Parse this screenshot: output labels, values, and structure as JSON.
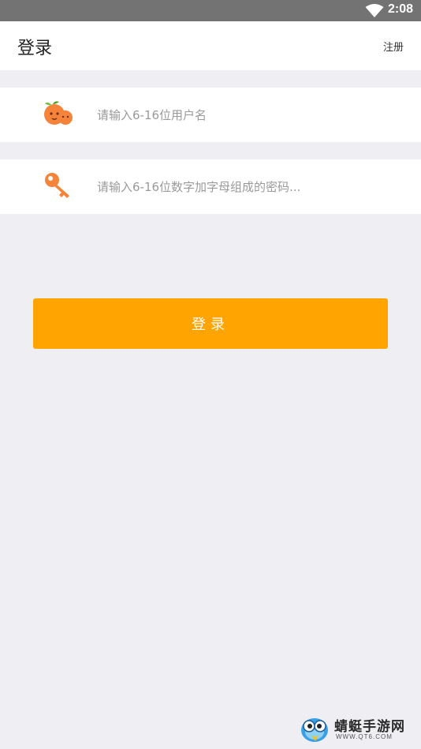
{
  "status_bar": {
    "time": "2:08"
  },
  "app_bar": {
    "title": "登录",
    "register_label": "注册"
  },
  "form": {
    "username_placeholder": "请输入6-16位用户名",
    "password_placeholder": "请输入6-16位数字加字母组成的密码..."
  },
  "login_button": {
    "label": "登录"
  },
  "watermark": {
    "name": "蜻蜓手游网",
    "url": "WWW.QT6.COM"
  },
  "colors": {
    "accent": "#ffa400",
    "icon_orange": "#f5833a",
    "background": "#efeef3"
  }
}
